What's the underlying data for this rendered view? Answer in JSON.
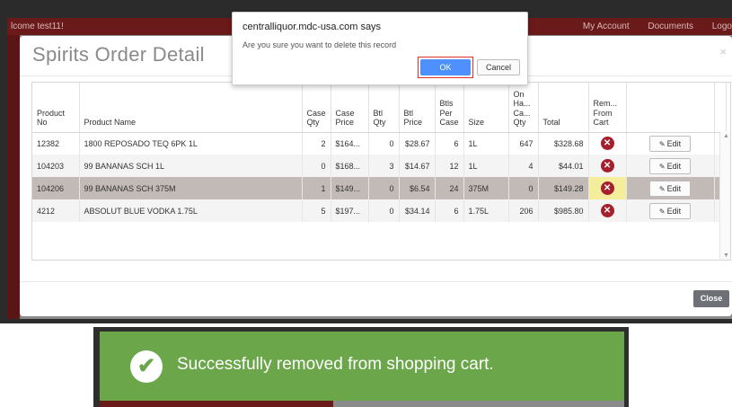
{
  "app": {
    "welcome": "lcome test11!",
    "links": [
      "My Account",
      "Documents",
      "Logo"
    ]
  },
  "modal": {
    "title": "Spirits Order Detail",
    "close_x": "×",
    "close_button": "Close"
  },
  "table": {
    "headers": {
      "product_no": "Product No",
      "product_name": "Product Name",
      "case_qty": "Case Qty",
      "case_price": "Case Price",
      "btl_qty": "Btl Qty",
      "btl_price": "Btl Price",
      "btls_per_case": "Btls Per Case",
      "size": "Size",
      "on_hand_case_qty": "On Ha... Ca... Qty",
      "total": "Total",
      "remove_from_cart": "Rem... From Cart"
    },
    "edit_label": "Edit",
    "rows": [
      {
        "product_no": "12382",
        "product_name": "1800 REPOSADO TEQ 6PK 1L",
        "case_qty": "2",
        "case_price": "$164...",
        "btl_qty": "0",
        "btl_price": "$28.67",
        "btls_per_case": "6",
        "size": "1L",
        "on_hand": "647",
        "total": "$328.68"
      },
      {
        "product_no": "104203",
        "product_name": "99 BANANAS SCH 1L",
        "case_qty": "0",
        "case_price": "$168...",
        "btl_qty": "3",
        "btl_price": "$14.67",
        "btls_per_case": "12",
        "size": "1L",
        "on_hand": "4",
        "total": "$44.01"
      },
      {
        "product_no": "104206",
        "product_name": "99 BANANAS SCH 375M",
        "case_qty": "1",
        "case_price": "$149...",
        "btl_qty": "0",
        "btl_price": "$6.54",
        "btls_per_case": "24",
        "size": "375M",
        "on_hand": "0",
        "total": "$149.28"
      },
      {
        "product_no": "4212",
        "product_name": "ABSOLUT BLUE VODKA 1.75L",
        "case_qty": "5",
        "case_price": "$197...",
        "btl_qty": "0",
        "btl_price": "$34.14",
        "btls_per_case": "6",
        "size": "1.75L",
        "on_hand": "206",
        "total": "$985.80"
      }
    ]
  },
  "confirm_dialog": {
    "origin": "centralliquor.mdc-usa.com says",
    "message": "Are you sure you want to delete this record",
    "ok_label": "OK",
    "cancel_label": "Cancel"
  },
  "toast": {
    "message": "Successfully removed from shopping cart.",
    "color": "#6ba64a"
  },
  "icons": {
    "remove": "x-circle-icon",
    "edit": "pencil-icon",
    "success": "checkmark-circle-icon"
  }
}
